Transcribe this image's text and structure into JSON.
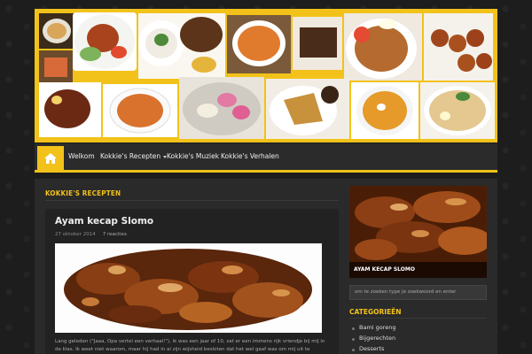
{
  "nav": {
    "home_icon": "home-icon",
    "items": [
      {
        "label": "Welkom"
      },
      {
        "label": "Kokkie's Recepten",
        "has_dropdown": true
      },
      {
        "label": "Kokkie's Muziek"
      },
      {
        "label": "Kokkie's Verhalen"
      }
    ]
  },
  "main": {
    "section_title": "KOKKIE'S RECEPTEN",
    "post": {
      "title": "Ayam kecap Slomo",
      "date": "27 oktober 2014",
      "comments": "7 reacties",
      "excerpt": "Lang geleden (\"Jaaa, Opa vertel een verhaal!\"), ik was een jaar of 10, zat er een immens rijk vriendje bij mij in de klas. Ik weet niet waarom, maar hij had in al zijn wijsheid besloten dat het wel gaaf was om mij uit te schelden. Bijna"
    }
  },
  "sidebar": {
    "featured_caption": "AYAM KECAP SLOMO",
    "search_placeholder": "om te zoeken type je zoekwoord en enter",
    "categories_title": "CATEGORIEËN",
    "categories": [
      "Bami goreng",
      "Bijgerechten",
      "Desserts"
    ]
  },
  "colors": {
    "accent": "#f2c21a",
    "background": "#1d1d1d",
    "nav_bg": "#2b2b2b",
    "content_bg": "#2a2a2a"
  }
}
